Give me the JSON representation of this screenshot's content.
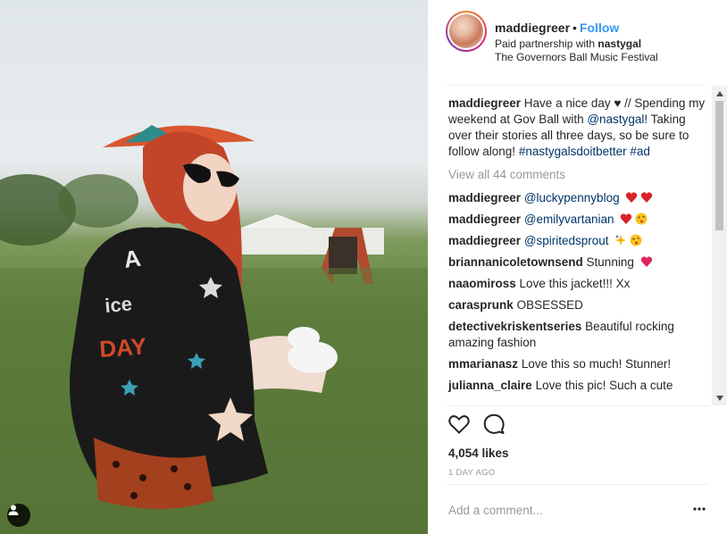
{
  "post": {
    "username": "maddiegreer",
    "separator": "•",
    "follow_label": "Follow",
    "partnership_prefix": "Paid partnership with ",
    "partner": "nastygal",
    "location": "The Governors Ball Music Festival"
  },
  "caption": {
    "username": "maddiegreer",
    "text_1": " Have a nice day ♥ // Spending my weekend at Gov Ball with ",
    "mention": "@nastygal",
    "text_2": "! Taking over their stories all three days, so be sure to follow along! ",
    "hashtag_1": "#nastygalsdoitbetter",
    "hashtag_2": "#ad"
  },
  "view_all_comments": "View all 44 comments",
  "comments": [
    {
      "username": "maddiegreer",
      "mention": "@luckypennyblog",
      "text": "",
      "emoji": [
        "heart-eyes-icon",
        "heart-eyes-icon"
      ]
    },
    {
      "username": "maddiegreer",
      "mention": "@emilyvartanian",
      "text": "",
      "emoji": [
        "heart-eyes-icon",
        "kiss-face-icon"
      ]
    },
    {
      "username": "maddiegreer",
      "mention": "@spiritedsprout",
      "text": "",
      "emoji": [
        "sparkle-icon",
        "kiss-face-icon"
      ]
    },
    {
      "username": "briannanicoletownsend",
      "mention": "",
      "text": "Stunning",
      "emoji": [
        "red-heart-icon"
      ]
    },
    {
      "username": "naaomiross",
      "mention": "",
      "text": "Love this jacket!!! Xx",
      "emoji": []
    },
    {
      "username": "carasprunk",
      "mention": "",
      "text": "OBSESSED",
      "emoji": []
    },
    {
      "username": "detectivekriskentseries",
      "mention": "",
      "text": "Beautiful rocking amazing fashion",
      "emoji": []
    },
    {
      "username": "mmarianasz",
      "mention": "",
      "text": "Love this so much! Stunner!",
      "emoji": []
    },
    {
      "username": "julianna_claire",
      "mention": "",
      "text": "Love this pic! Such a cute",
      "emoji": []
    }
  ],
  "likes": "4,054 likes",
  "timestamp": "1 DAY AGO",
  "add_comment_placeholder": "Add a comment...",
  "more_label": "•••",
  "icons": {
    "like": "heart-outline-icon",
    "comment": "speech-bubble-icon",
    "user_tag": "user-silhouette-icon",
    "more": "ellipsis-icon"
  },
  "colors": {
    "follow": "#3897f0",
    "link": "#003569",
    "muted": "#999999",
    "text": "#262626"
  }
}
